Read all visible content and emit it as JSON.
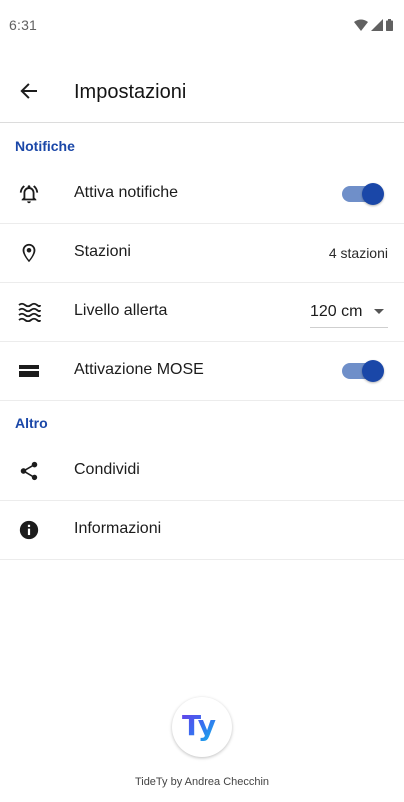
{
  "status_bar": {
    "time": "6:31"
  },
  "app_bar": {
    "title": "Impostazioni"
  },
  "sections": {
    "notifiche": {
      "title": "Notifiche",
      "attiva_notifiche": {
        "label": "Attiva notifiche",
        "enabled": true
      },
      "stazioni": {
        "label": "Stazioni",
        "value": "4 stazioni"
      },
      "livello_allerta": {
        "label": "Livello allerta",
        "value": "120 cm"
      },
      "attivazione_mose": {
        "label": "Attivazione MOSE",
        "enabled": true
      }
    },
    "altro": {
      "title": "Altro",
      "condividi": {
        "label": "Condividi"
      },
      "informazioni": {
        "label": "Informazioni"
      }
    }
  },
  "footer": {
    "logo_text": "Ty",
    "credit": "TideTy by Andrea Checchin"
  },
  "colors": {
    "accent": "#1a47a8",
    "toggle_track": "#6f8fc9"
  }
}
